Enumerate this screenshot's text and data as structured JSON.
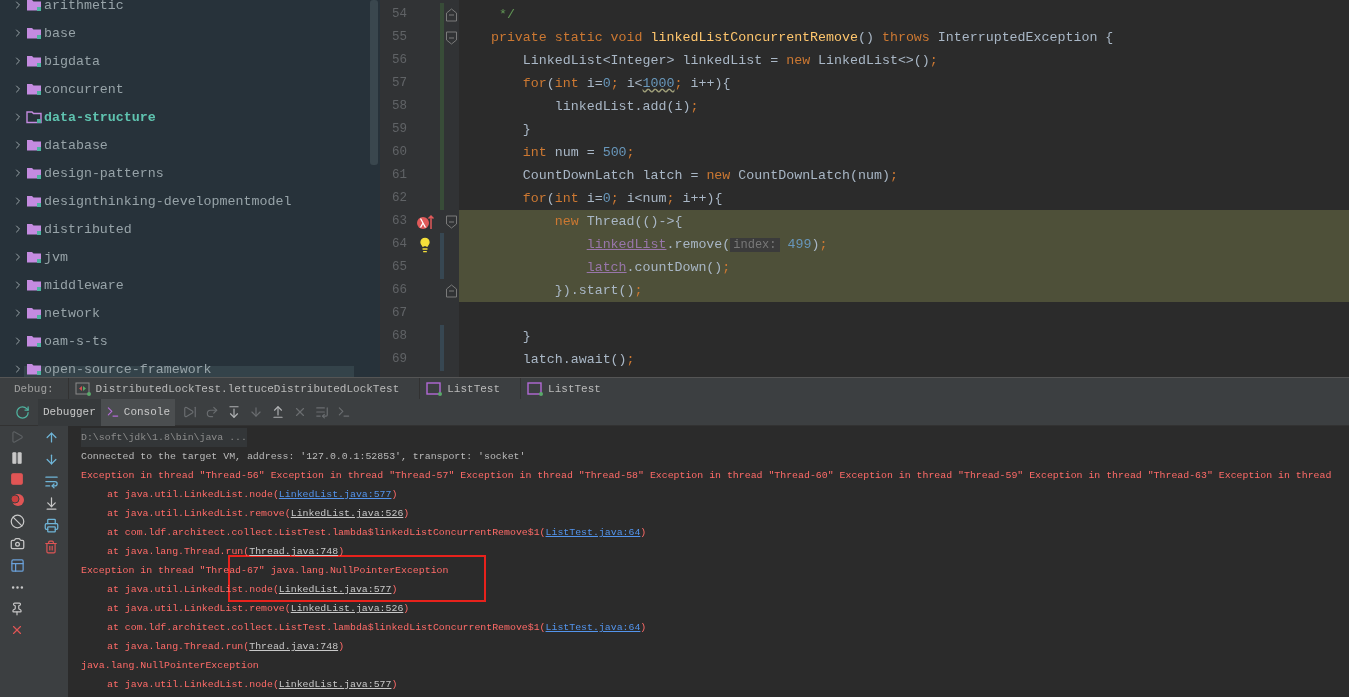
{
  "project_tree": {
    "items": [
      {
        "label": "arithmetic",
        "current": false
      },
      {
        "label": "base",
        "current": false
      },
      {
        "label": "bigdata",
        "current": false
      },
      {
        "label": "concurrent",
        "current": false
      },
      {
        "label": "data-structure",
        "current": true
      },
      {
        "label": "database",
        "current": false
      },
      {
        "label": "design-patterns",
        "current": false
      },
      {
        "label": "designthinking-developmentmodel",
        "current": false
      },
      {
        "label": "distributed",
        "current": false
      },
      {
        "label": "jvm",
        "current": false
      },
      {
        "label": "middleware",
        "current": false
      },
      {
        "label": "network",
        "current": false
      },
      {
        "label": "oam-s-ts",
        "current": false
      },
      {
        "label": "open-source-framework",
        "current": false
      }
    ]
  },
  "editor": {
    "lines": [
      {
        "number": "54",
        "fold_end": true,
        "added": true,
        "tokens": [
          {
            "kind": "comment",
            "text": "     */"
          }
        ]
      },
      {
        "number": "55",
        "fold_start": true,
        "added": true,
        "tokens": [
          {
            "kind": "keyword",
            "text": "    private static void "
          },
          {
            "kind": "declaration",
            "text": "linkedListConcurrentRemove"
          },
          {
            "kind": "plain",
            "text": "() "
          },
          {
            "kind": "keyword",
            "text": "throws "
          },
          {
            "kind": "plain",
            "text": "InterruptedException {"
          }
        ]
      },
      {
        "number": "56",
        "added": true,
        "tokens": [
          {
            "kind": "plain",
            "text": "        LinkedList<Integer> linkedList = "
          },
          {
            "kind": "keyword",
            "text": "new "
          },
          {
            "kind": "plain",
            "text": "LinkedList<>()"
          },
          {
            "kind": "punct",
            "text": ";"
          }
        ]
      },
      {
        "number": "57",
        "added": true,
        "tokens": [
          {
            "kind": "keyword",
            "text": "        for"
          },
          {
            "kind": "plain",
            "text": "("
          },
          {
            "kind": "keyword",
            "text": "int "
          },
          {
            "kind": "plain",
            "text": "i="
          },
          {
            "kind": "number",
            "text": "0"
          },
          {
            "kind": "punct",
            "text": "; "
          },
          {
            "kind": "plain",
            "text": "i<"
          },
          {
            "kind": "warning",
            "text": "1000"
          },
          {
            "kind": "punct",
            "text": "; "
          },
          {
            "kind": "plain",
            "text": "i++){"
          }
        ]
      },
      {
        "number": "58",
        "added": true,
        "tokens": [
          {
            "kind": "plain",
            "text": "            linkedList.add(i)"
          },
          {
            "kind": "punct",
            "text": ";"
          }
        ]
      },
      {
        "number": "59",
        "added": true,
        "tokens": [
          {
            "kind": "plain",
            "text": "        }"
          }
        ]
      },
      {
        "number": "60",
        "added": true,
        "tokens": [
          {
            "kind": "keyword",
            "text": "        int "
          },
          {
            "kind": "plain",
            "text": "num = "
          },
          {
            "kind": "number",
            "text": "500"
          },
          {
            "kind": "punct",
            "text": ";"
          }
        ]
      },
      {
        "number": "61",
        "added": true,
        "tokens": [
          {
            "kind": "plain",
            "text": "        CountDownLatch latch = "
          },
          {
            "kind": "keyword",
            "text": "new "
          },
          {
            "kind": "plain",
            "text": "CountDownLatch(num)"
          },
          {
            "kind": "punct",
            "text": ";"
          }
        ]
      },
      {
        "number": "62",
        "added": true,
        "tokens": [
          {
            "kind": "keyword",
            "text": "        for"
          },
          {
            "kind": "plain",
            "text": "("
          },
          {
            "kind": "keyword",
            "text": "int "
          },
          {
            "kind": "plain",
            "text": "i="
          },
          {
            "kind": "number",
            "text": "0"
          },
          {
            "kind": "punct",
            "text": "; "
          },
          {
            "kind": "plain",
            "text": "i<num"
          },
          {
            "kind": "punct",
            "text": "; "
          },
          {
            "kind": "plain",
            "text": "i++){"
          }
        ]
      },
      {
        "number": "63",
        "fold_start": true,
        "breakpoint": true,
        "highlighted": true,
        "tokens": [
          {
            "kind": "keyword",
            "text": "            new "
          },
          {
            "kind": "plain",
            "text": "Thread(()->{"
          }
        ]
      },
      {
        "number": "64",
        "intention_bulb": true,
        "modified": true,
        "highlighted": true,
        "tokens": [
          {
            "kind": "field",
            "text": "                linkedList"
          },
          {
            "kind": "plain",
            "text": ".remove("
          },
          {
            "kind": "hint",
            "text": "index:"
          },
          {
            "kind": "number",
            "text": " 499"
          },
          {
            "kind": "plain",
            "text": ")"
          },
          {
            "kind": "punct",
            "text": ";"
          }
        ]
      },
      {
        "number": "65",
        "modified": true,
        "highlighted": true,
        "tokens": [
          {
            "kind": "field",
            "text": "                latch"
          },
          {
            "kind": "plain",
            "text": ".countDown()"
          },
          {
            "kind": "punct",
            "text": ";"
          }
        ]
      },
      {
        "number": "66",
        "fold_end": true,
        "highlighted": true,
        "tokens": [
          {
            "kind": "plain",
            "text": "            }).start()"
          },
          {
            "kind": "punct",
            "text": ";"
          }
        ]
      },
      {
        "number": "67"
      },
      {
        "number": "68",
        "modified": true,
        "tokens": [
          {
            "kind": "plain",
            "text": "        }"
          }
        ]
      },
      {
        "number": "69",
        "modified": true,
        "tokens": [
          {
            "kind": "plain",
            "text": "        latch.await()"
          },
          {
            "kind": "punct",
            "text": ";"
          }
        ]
      }
    ]
  },
  "debug_bar": {
    "label": "Debug:",
    "sessions": [
      {
        "label": "DistributedLockTest.lettuceDistributedLockTest",
        "kind": "test"
      },
      {
        "label": "ListTest",
        "kind": "app"
      },
      {
        "label": "ListTest",
        "kind": "app"
      }
    ]
  },
  "debug_tabs": [
    {
      "label": "Debugger",
      "selected": false
    },
    {
      "label": "Console",
      "selected": true
    }
  ],
  "console": {
    "lines": [
      {
        "kind": "command",
        "text": "D:\\soft\\jdk\\1.8\\bin\\java ..."
      },
      {
        "kind": "info",
        "text": "Connected to the target VM, address: '127.0.0.1:52853', transport: 'socket'"
      },
      {
        "kind": "error",
        "text": "Exception in thread \"Thread-56\" Exception in thread \"Thread-57\" Exception in thread \"Thread-58\" Exception in thread \"Thread-60\" Exception in thread \"Thread-59\" Exception in thread \"Thread-63\" Exception in thread"
      },
      {
        "kind": "frame",
        "text": "at java.util.LinkedList.node(",
        "link": "LinkedList.java:577",
        "visited": false,
        "suffix": ")"
      },
      {
        "kind": "frame",
        "text": "at java.util.LinkedList.remove(",
        "link": "LinkedList.java:526",
        "visited": true,
        "suffix": ")"
      },
      {
        "kind": "frame",
        "text": "at com.ldf.architect.collect.ListTest.lambda$linkedListConcurrentRemove$1(",
        "link": "ListTest.java:64",
        "visited": false,
        "suffix": ")"
      },
      {
        "kind": "frame",
        "text": "at java.lang.Thread.run(",
        "link": "Thread.java:748",
        "visited": true,
        "suffix": ")"
      },
      {
        "kind": "error",
        "text": "Exception in thread \"Thread-67\" java.lang.NullPointerException"
      },
      {
        "kind": "frame",
        "text": "at java.util.LinkedList.node(",
        "link": "LinkedList.java:577",
        "visited": true,
        "suffix": ")"
      },
      {
        "kind": "frame",
        "text": "at java.util.LinkedList.remove(",
        "link": "LinkedList.java:526",
        "visited": true,
        "suffix": ")"
      },
      {
        "kind": "frame",
        "text": "at com.ldf.architect.collect.ListTest.lambda$linkedListConcurrentRemove$1(",
        "link": "ListTest.java:64",
        "visited": false,
        "suffix": ")"
      },
      {
        "kind": "frame",
        "text": "at java.lang.Thread.run(",
        "link": "Thread.java:748",
        "visited": true,
        "suffix": ")"
      },
      {
        "kind": "error",
        "text": "java.lang.NullPointerException"
      },
      {
        "kind": "frame",
        "text": "at java.util.LinkedList.node(",
        "link": "LinkedList.java:577",
        "visited": true,
        "suffix": ")"
      }
    ]
  }
}
